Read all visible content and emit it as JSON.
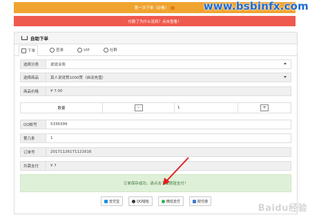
{
  "banners": {
    "top": "第一次下单（必看）",
    "second": "付款了为什么没到？点击查看！"
  },
  "watermark": "www.bsbinfx.com",
  "panel": {
    "title": "自助下单",
    "tabs": [
      {
        "label": "下单",
        "icon": "cart-icon"
      },
      {
        "label": "查单",
        "icon": "search-icon"
      },
      {
        "label": "VIP",
        "icon": "user-icon"
      },
      {
        "label": "社群",
        "icon": "group-icon"
      }
    ]
  },
  "form": {
    "category_label": "选择分类",
    "category_value": "说说业务",
    "product_label": "选择商品",
    "product_value": "真人说说赞1000赞（自动充值）",
    "price_label": "商品价格",
    "price_value": "¥ 7.00",
    "qty_label": "数量",
    "qty_minus": "-",
    "qty_value": "1",
    "qty_plus": "+",
    "qq_label": "QQ帐号",
    "qq_value": "5336399",
    "row_label": "第几条",
    "row_value": "1",
    "order_label": "订单号",
    "order_value": "20171126171121616",
    "total_label": "共需支付",
    "total_value": "¥ 7"
  },
  "notice": "订单保存成功，请点击下面按钮支付！",
  "payments": [
    {
      "label": "支付宝",
      "color": "#1a8fe3",
      "icon": "alipay-icon"
    },
    {
      "label": "QQ钱包",
      "color": "#333333",
      "icon": "qq-icon"
    },
    {
      "label": "微信支付",
      "color": "#2bb24c",
      "icon": "wechat-icon"
    },
    {
      "label": "财付通",
      "color": "#3a7bd5",
      "icon": "tenpay-icon"
    }
  ],
  "baidu": "Baidu经验"
}
